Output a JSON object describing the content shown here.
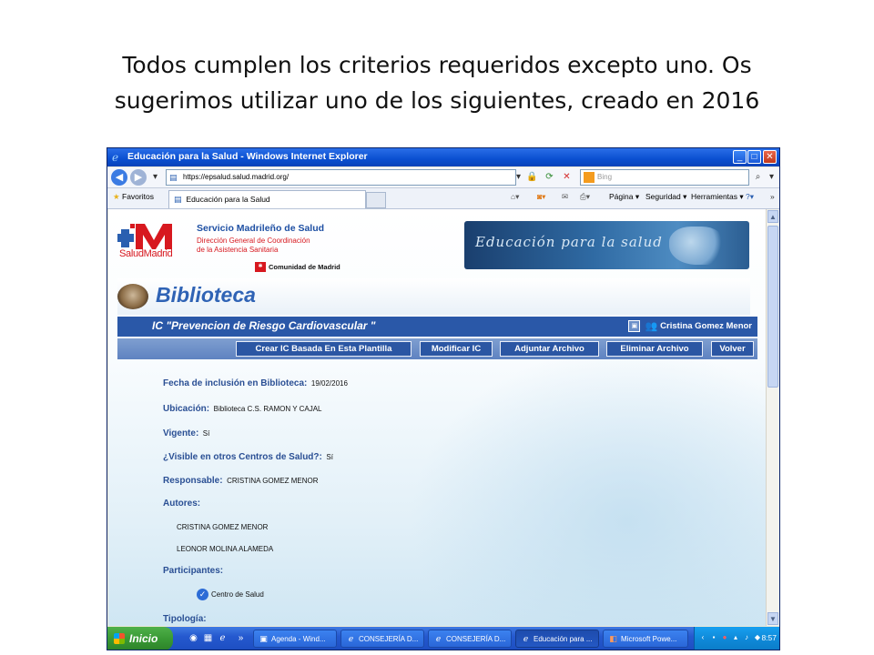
{
  "slide": {
    "title_line1": "Todos cumplen los criterios requeridos excepto uno. Os",
    "title_line2": "sugerimos utilizar uno de los siguientes, creado en 2016"
  },
  "window": {
    "title": "Educación para la Salud - Windows Internet Explorer"
  },
  "address_bar": {
    "url": "https://epsalud.salud.madrid.org/",
    "search_placeholder": "Bing"
  },
  "favorites_bar": {
    "favorites_label": "Favoritos",
    "tab_label": "Educación para la Salud",
    "commands": [
      "Página ▾",
      "Seguridad ▾",
      "Herramientas ▾"
    ]
  },
  "site_header": {
    "logo_sub": "SaludMadrid",
    "org_title": "Servicio Madrileño de Salud",
    "org_sub1": "Dirección General de Coordinación",
    "org_sub2": "de la Asistencia Sanitaria",
    "community": "Comunidad de Madrid",
    "banner_text": "Educación para la salud"
  },
  "biblioteca": {
    "title": "Biblioteca"
  },
  "record": {
    "title": "IC \"Prevencion de Riesgo Cardiovascular \"",
    "user_name": "Cristina Gomez Menor"
  },
  "actions": {
    "crear": "Crear IC Basada En Esta Plantilla",
    "modificar": "Modificar IC",
    "adjuntar": "Adjuntar Archivo",
    "eliminar": "Eliminar Archivo",
    "volver": "Volver"
  },
  "details": {
    "fecha_label": "Fecha de inclusión en Biblioteca:",
    "fecha_value": "19/02/2016",
    "ubicacion_label": "Ubicación:",
    "ubicacion_value": "Biblioteca C.S. RAMON Y CAJAL",
    "vigente_label": "Vigente:",
    "vigente_value": "Sí",
    "visible_label": "¿Visible en otros Centros de Salud?:",
    "visible_value": "Sí",
    "responsable_label": "Responsable:",
    "responsable_value": "CRISTINA GOMEZ MENOR",
    "autores_label": "Autores:",
    "autores": [
      "CRISTINA GOMEZ MENOR",
      "LEONOR MOLINA ALAMEDA"
    ],
    "participantes_label": "Participantes:",
    "participante": "Centro de Salud",
    "tipologia_label": "Tipología:"
  },
  "taskbar": {
    "start_label": "Inicio",
    "tasks": [
      "Agenda - Wind...",
      "CONSEJERÍA D...",
      "CONSEJERÍA D...",
      "Educación para ...",
      "Microsoft Powe..."
    ],
    "clock": "8:57"
  },
  "colors": {
    "accent_blue": "#2a58a8",
    "brand_red": "#d7181f"
  }
}
